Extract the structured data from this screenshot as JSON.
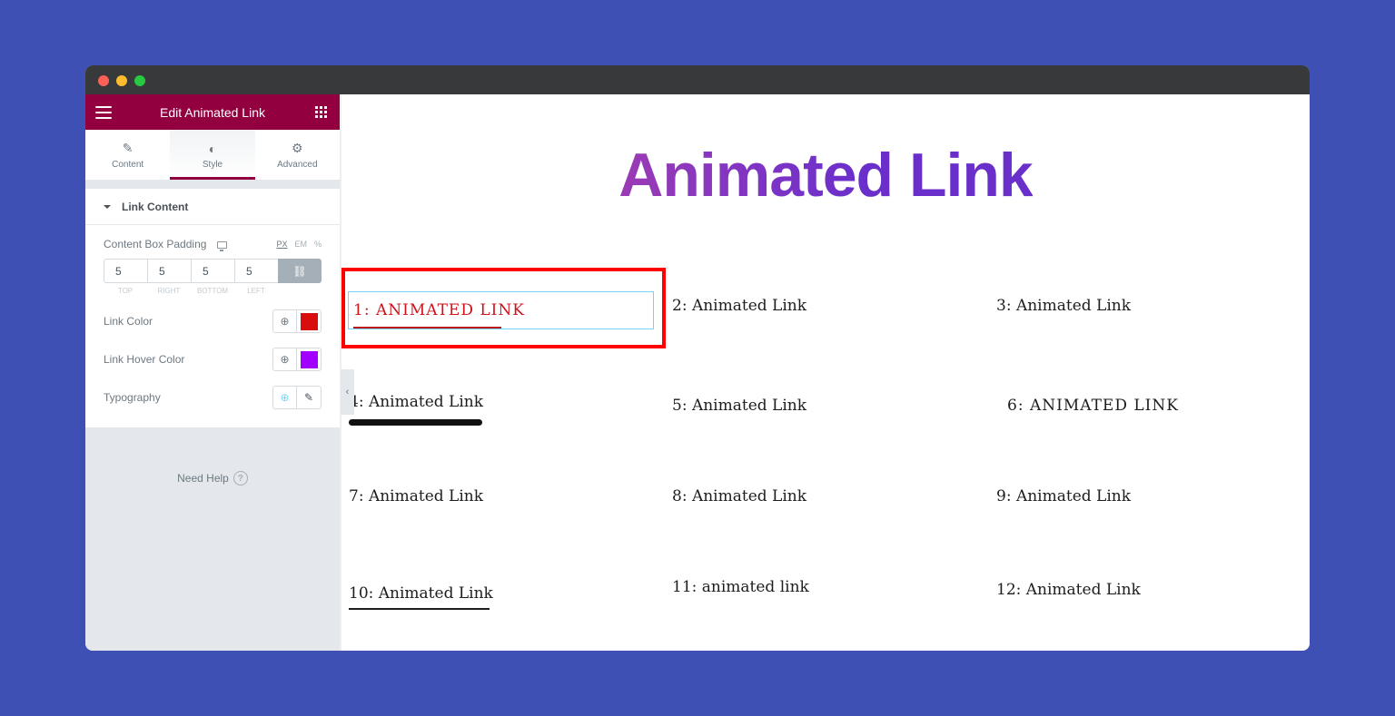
{
  "window": {
    "controls": [
      "close",
      "minimize",
      "maximize"
    ]
  },
  "sidebar": {
    "header_title": "Edit Animated Link",
    "menu_icon": "hamburger-icon",
    "apps_icon": "grid-icon",
    "tabs": [
      {
        "label": "Content",
        "icon": "pencil-icon",
        "glyph": "✎",
        "active": false
      },
      {
        "label": "Style",
        "icon": "half-circle-icon",
        "glyph": "◐",
        "active": true
      },
      {
        "label": "Advanced",
        "icon": "gear-icon",
        "glyph": "⚙",
        "active": false
      }
    ],
    "section": {
      "title": "Link Content",
      "padding": {
        "label": "Content Box Padding",
        "units": [
          "PX",
          "EM",
          "%"
        ],
        "active_unit": "PX",
        "values": {
          "top": "5",
          "right": "5",
          "bottom": "5",
          "left": "5"
        },
        "sides": [
          "Top",
          "Right",
          "Bottom",
          "Left"
        ],
        "link_glyph": "🔗"
      },
      "link_color": {
        "label": "Link Color",
        "value": "#d80e0e"
      },
      "link_hover_color": {
        "label": "Link Hover Color",
        "value": "#a100ff"
      },
      "typography": {
        "label": "Typography"
      }
    },
    "globe_glyph": "🌐",
    "pencil_glyph": "✎",
    "help": {
      "label": "Need Help",
      "glyph": "?"
    },
    "collapse_glyph": "‹"
  },
  "canvas": {
    "heading": "Animated Link",
    "links": [
      {
        "n": 1,
        "text": "1: ANIMATED LINK"
      },
      {
        "n": 2,
        "text": "2: Animated Link"
      },
      {
        "n": 3,
        "text": "3: Animated Link"
      },
      {
        "n": 4,
        "text": "4: Animated Link"
      },
      {
        "n": 5,
        "text": "5: Animated Link"
      },
      {
        "n": 6,
        "text": "6: ANIMATED LINK"
      },
      {
        "n": 7,
        "text": "7: Animated Link"
      },
      {
        "n": 8,
        "text": "8: Animated Link"
      },
      {
        "n": 9,
        "text": "9: Animated Link"
      },
      {
        "n": 10,
        "text": "10: Animated Link"
      },
      {
        "n": 11,
        "text": "11: animated link"
      },
      {
        "n": 12,
        "text": "12: Animated Link"
      }
    ]
  },
  "colors": {
    "background": "#3e50b4",
    "brand": "#93003f",
    "heading_gradient_start": "#9b3bb4",
    "heading_gradient_end": "#6a2fcb",
    "selection_outline": "#ff0000"
  }
}
